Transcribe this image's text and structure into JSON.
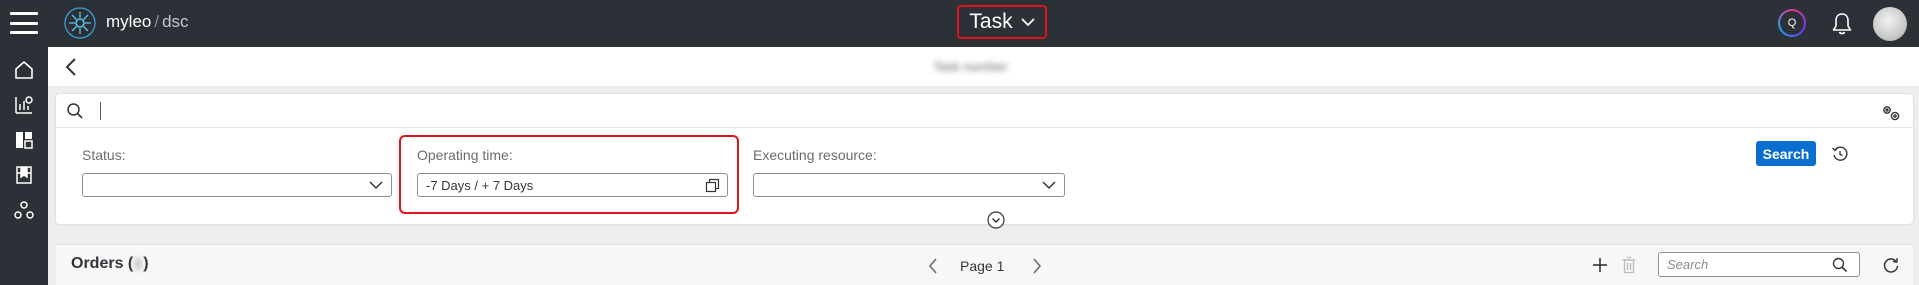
{
  "header": {
    "brand": "myleo",
    "brand_separator": "/",
    "brand_sub": "dsc",
    "app_switch_label": "Task",
    "assistant_badge": "Q"
  },
  "subheader": {
    "title": "Task number"
  },
  "search": {
    "value": ""
  },
  "filters": {
    "status": {
      "label": "Status:",
      "value": ""
    },
    "operating_time": {
      "label": "Operating time:",
      "value": "-7 Days / + 7 Days"
    },
    "executing_resource": {
      "label": "Executing resource:",
      "value": ""
    },
    "search_button": "Search"
  },
  "orders": {
    "title_prefix": "Orders (",
    "title_suffix": ")",
    "page_label": "Page 1",
    "search_placeholder": "Search"
  },
  "colors": {
    "topbar": "#2b3137",
    "accent": "#0a6ed1",
    "highlight": "#e0141c"
  },
  "icons": [
    "menu-icon",
    "logo-icon",
    "chevron-down-icon",
    "assistant-icon",
    "bell-icon",
    "home-icon",
    "analytics-icon",
    "dashboard-icon",
    "inventory-icon",
    "resources-icon",
    "back-icon",
    "search-icon",
    "settings-icon",
    "copy-icon",
    "reset-icon",
    "expand-icon",
    "chevron-left-icon",
    "chevron-right-icon",
    "add-icon",
    "trash-icon",
    "refresh-icon"
  ]
}
